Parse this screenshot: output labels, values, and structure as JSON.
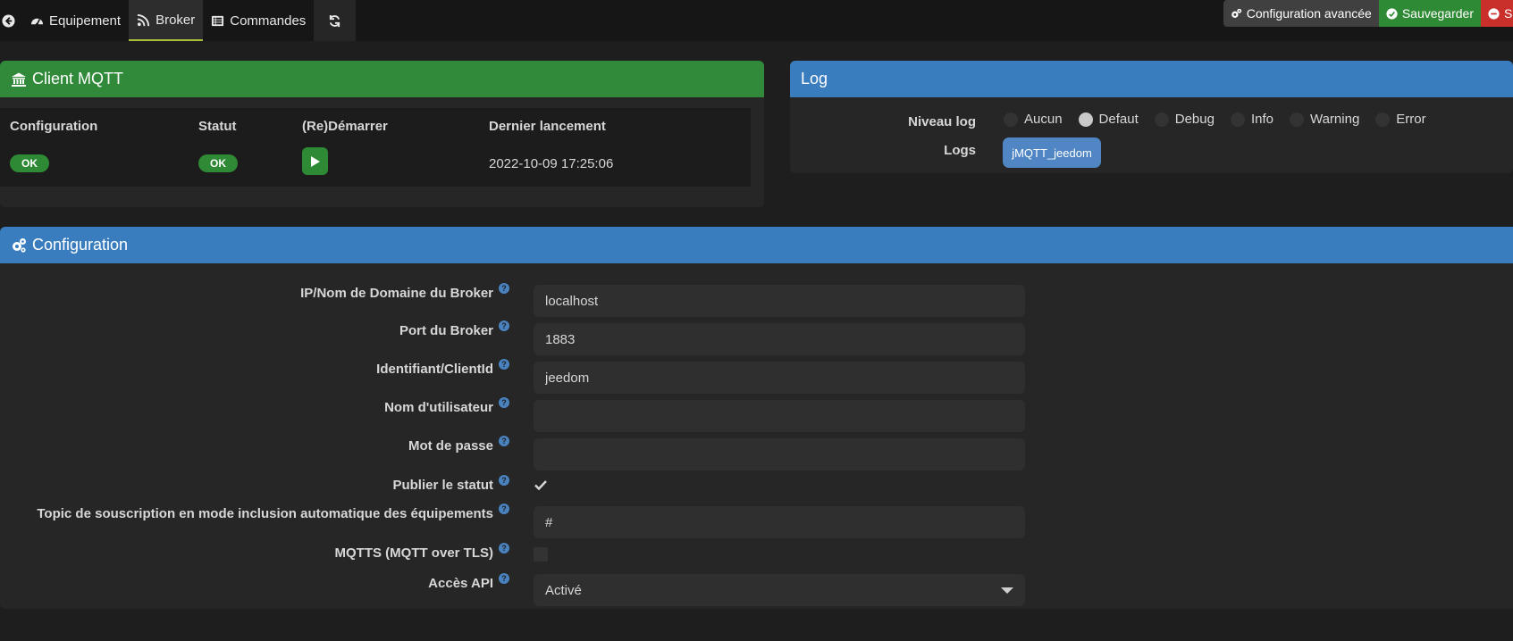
{
  "tabs": [
    {
      "label": "Equipement",
      "icon": "dashboard-icon"
    },
    {
      "label": "Broker",
      "icon": "rss-icon"
    },
    {
      "label": "Commandes",
      "icon": "list-icon"
    }
  ],
  "actions": {
    "advanced_label": "Configuration avancée",
    "save_label": "Sauvegarder",
    "delete_label": "Supprimer"
  },
  "client_panel": {
    "title": "Client MQTT",
    "headers": [
      "Configuration",
      "Statut",
      "(Re)Démarrer",
      "Dernier lancement"
    ],
    "configuration_status": "OK",
    "statut": "OK",
    "last_launch": "2022-10-09 17:25:06"
  },
  "log_panel": {
    "title": "Log",
    "level_label": "Niveau log",
    "levels": [
      "Aucun",
      "Defaut",
      "Debug",
      "Info",
      "Warning",
      "Error"
    ],
    "selected_level": "Defaut",
    "logs_label": "Logs",
    "log_button": "jMQTT_jeedom"
  },
  "config_panel": {
    "title": "Configuration",
    "host_label": "IP/Nom de Domaine du Broker",
    "host_value": "localhost",
    "port_label": "Port du Broker",
    "port_value": "1883",
    "clientid_label": "Identifiant/ClientId",
    "clientid_value": "jeedom",
    "user_label": "Nom d'utilisateur",
    "user_value": "",
    "password_label": "Mot de passe",
    "password_value": "",
    "publish_label": "Publier le statut",
    "publish_checked": true,
    "topic_label": "Topic de souscription en mode inclusion automatique des équipements",
    "topic_value": "#",
    "tls_label": "MQTTS (MQTT over TLS)",
    "tls_checked": false,
    "api_label": "Accès API",
    "api_value": "Activé"
  },
  "colors": {
    "green": "#2f8a36",
    "blue": "#3a7dbf",
    "red": "#c9302c",
    "accent": "#a9c238"
  }
}
